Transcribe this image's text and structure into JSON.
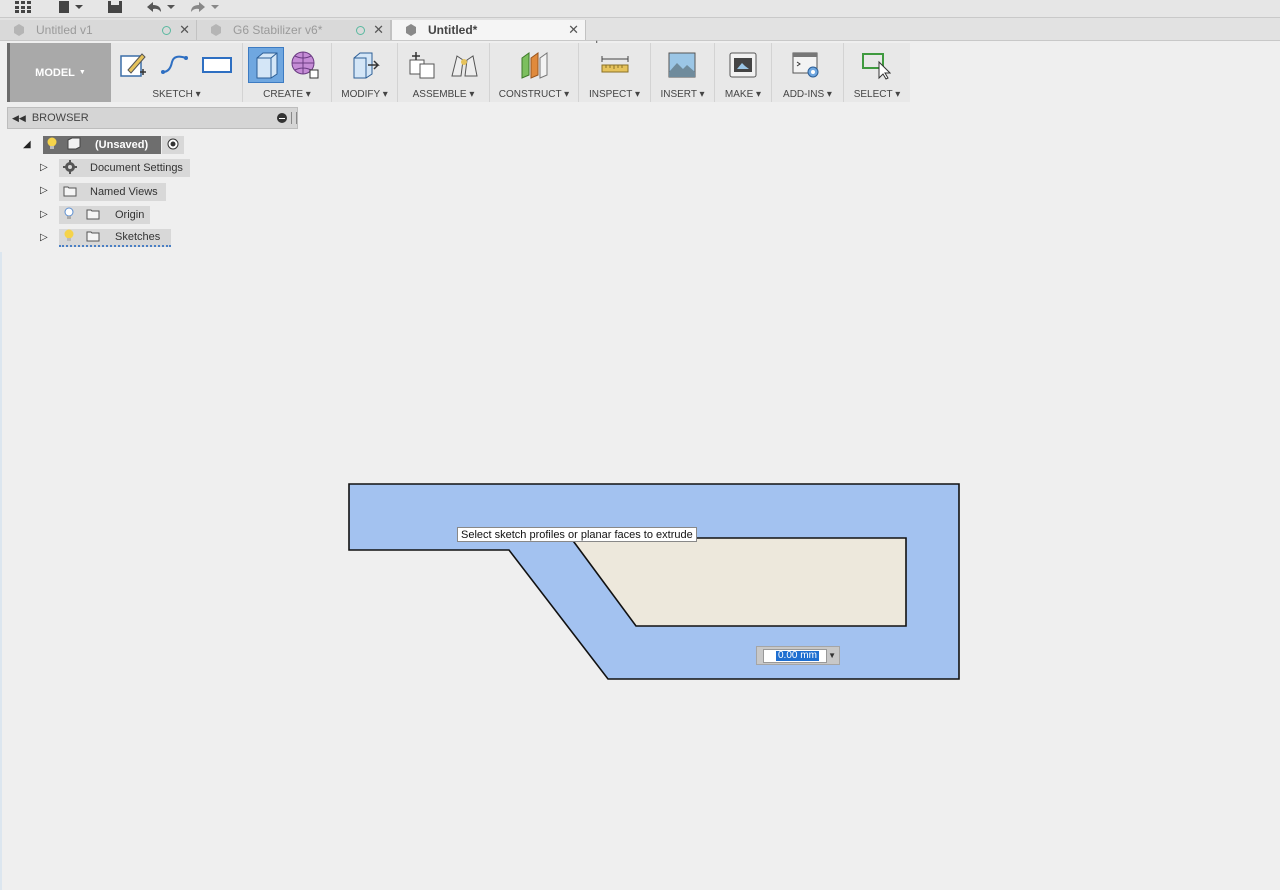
{
  "tabs": [
    {
      "label": "Untitled v1",
      "active": false,
      "has_status": true
    },
    {
      "label": "G6 Stabilizer v6*",
      "active": false,
      "has_status": true
    },
    {
      "label": "Untitled*",
      "active": true,
      "has_status": false
    }
  ],
  "toolbar": {
    "workspace": "MODEL",
    "groups": [
      {
        "label": "SKETCH"
      },
      {
        "label": "CREATE"
      },
      {
        "label": "MODIFY"
      },
      {
        "label": "ASSEMBLE"
      },
      {
        "label": "CONSTRUCT"
      },
      {
        "label": "INSPECT"
      },
      {
        "label": "INSERT"
      },
      {
        "label": "MAKE"
      },
      {
        "label": "ADD-INS"
      },
      {
        "label": "SELECT"
      }
    ]
  },
  "browser": {
    "title": "BROWSER",
    "root": "(Unsaved)",
    "items": [
      {
        "label": "Document Settings"
      },
      {
        "label": "Named Views"
      },
      {
        "label": "Origin"
      },
      {
        "label": "Sketches"
      }
    ]
  },
  "canvas": {
    "tooltip": "Select sketch profiles or planar faces to extrude",
    "distance_value": "0.00 mm"
  },
  "colors": {
    "profile_fill": "#a3c2f0",
    "inner_fill": "#ede8dc",
    "selected_tool": "#6fa7e0",
    "accent_status": "#5ab9a0"
  }
}
